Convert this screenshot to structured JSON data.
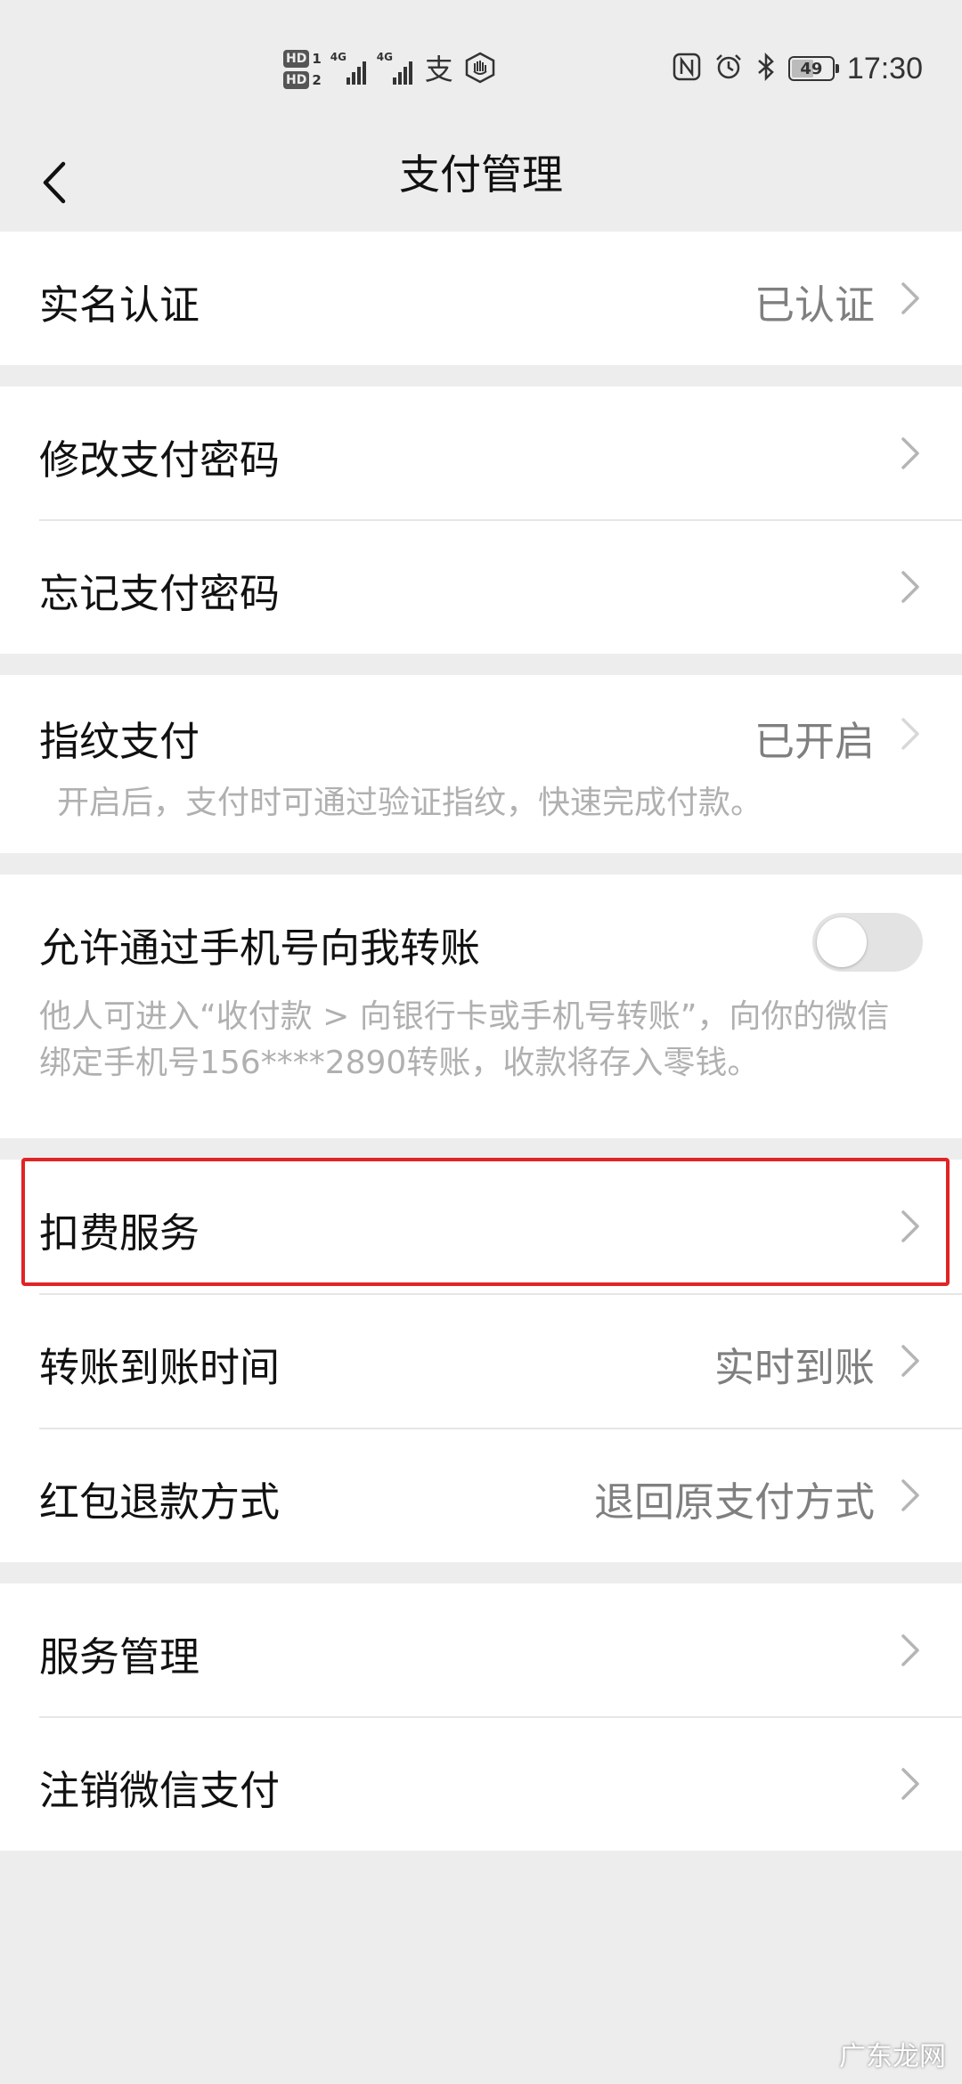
{
  "status_bar": {
    "hd1": "HD",
    "sim1": "1",
    "hd2": "HD",
    "sim2": "2",
    "net1": "4G",
    "net2": "4G",
    "alipay_glyph": "支",
    "battery": "49",
    "time": "17:30",
    "icons": [
      "nfc-icon",
      "alarm-icon",
      "bluetooth-icon",
      "battery-icon"
    ]
  },
  "nav": {
    "title": "支付管理",
    "back_icon": "chevron-left-icon"
  },
  "sections": {
    "verify": {
      "label": "实名认证",
      "value": "已认证"
    },
    "password": {
      "change": "修改支付密码",
      "forgot": "忘记支付密码"
    },
    "fingerprint": {
      "label": "指纹支付",
      "value": "已开启",
      "desc": "开启后，支付时可通过验证指纹，快速完成付款。"
    },
    "phone_transfer": {
      "label": "允许通过手机号向我转账",
      "enabled": false,
      "desc_line1": "他人可进入“收付款 > 向银行卡或手机号转账”，向你的微信",
      "desc_line2": "绑定手机号156****2890转账，收款将存入零钱。"
    },
    "deduction": {
      "label": "扣费服务"
    },
    "arrival": {
      "label": "转账到账时间",
      "value": "实时到账"
    },
    "refund": {
      "label": "红包退款方式",
      "value": "退回原支付方式"
    },
    "service": {
      "manage": "服务管理",
      "cancel": "注销微信支付"
    }
  },
  "highlight_color": "#e02424",
  "accent_colors": {
    "background": "#ededed",
    "card": "#ffffff",
    "value_text": "#7f7f7f",
    "hint_text": "#b0b0b0"
  },
  "watermark": "广东龙网"
}
